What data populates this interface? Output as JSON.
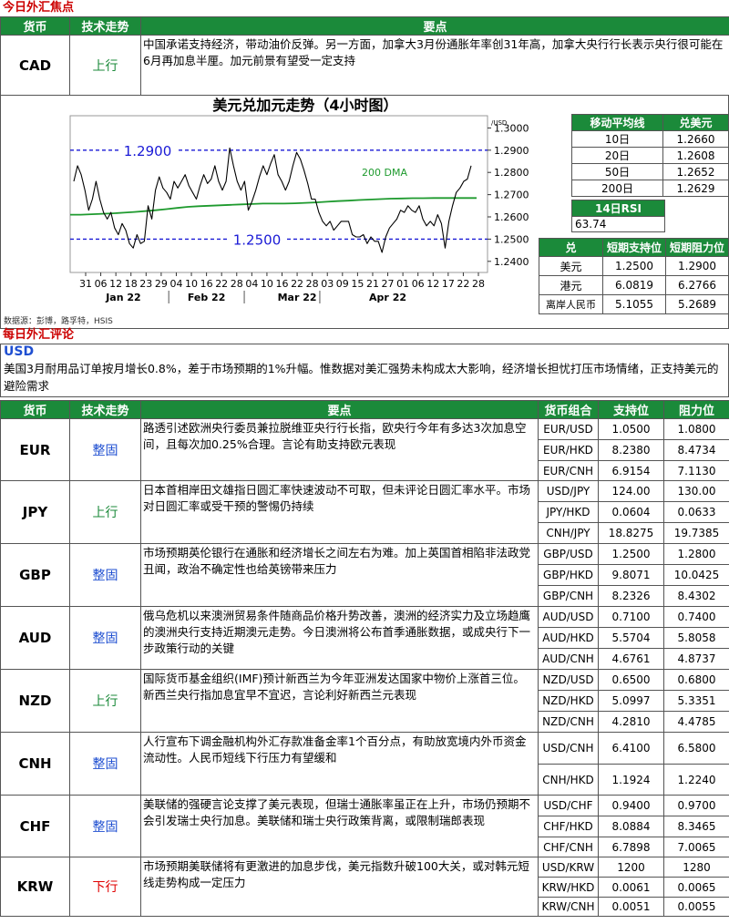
{
  "focus": {
    "section_title": "今日外汇焦点",
    "headers": {
      "currency": "货币",
      "trend": "技术走势",
      "points": "要点"
    },
    "row": {
      "currency": "CAD",
      "trend": "上行",
      "text": "中国承诺支持经济，带动油价反弹。另一方面，加拿大3月份通胀年率创31年高，加拿大央行行长表示央行很可能在6月再加息半厘。加元前景有望受一定支持"
    }
  },
  "chart_data": {
    "type": "line",
    "title": "美元兑加元走势（4小时图）",
    "ylabel": "/USD",
    "ylim": [
      1.235,
      1.3055
    ],
    "yticks": [
      "1.3000",
      "1.2900",
      "1.2800",
      "1.2700",
      "1.2600",
      "1.2500",
      "1.2400"
    ],
    "xticks": [
      "31",
      "06",
      "12",
      "18",
      "23",
      "29",
      "04",
      "10",
      "16",
      "22",
      "28",
      "04",
      "10",
      "16",
      "22",
      "28",
      "03",
      "09",
      "15",
      "21",
      "27",
      "01",
      "06",
      "12",
      "17",
      "22",
      "28"
    ],
    "month_labels": [
      "Jan 22",
      "Feb 22",
      "Mar 22",
      "Apr 22"
    ],
    "annotations": [
      {
        "text": "1.2900",
        "value": 1.29
      },
      {
        "text": "1.2500",
        "value": 1.25
      },
      {
        "text": "200 DMA"
      }
    ],
    "series": [
      {
        "values": [
          1.276,
          1.283,
          1.279,
          1.272,
          1.263,
          1.268,
          1.276,
          1.268,
          1.262,
          1.259,
          1.262,
          1.255,
          1.252,
          1.257,
          1.254,
          1.248,
          1.246,
          1.252,
          1.248,
          1.249,
          1.265,
          1.259,
          1.272,
          1.278,
          1.273,
          1.271,
          1.268,
          1.276,
          1.273,
          1.276,
          1.279,
          1.274,
          1.271,
          1.268,
          1.274,
          1.279,
          1.275,
          1.277,
          1.283,
          1.276,
          1.272,
          1.276,
          1.291,
          1.283,
          1.276,
          1.272,
          1.276,
          1.263,
          1.267,
          1.272,
          1.278,
          1.283,
          1.279,
          1.284,
          1.288,
          1.279,
          1.276,
          1.272,
          1.276,
          1.283,
          1.289,
          1.286,
          1.281,
          1.275,
          1.268,
          1.268,
          1.262,
          1.258,
          1.256,
          1.258,
          1.254,
          1.256,
          1.258,
          1.258,
          1.258,
          1.252,
          1.251,
          1.251,
          1.252,
          1.248,
          1.251,
          1.249,
          1.249,
          1.244,
          1.251,
          1.255,
          1.257,
          1.259,
          1.263,
          1.262,
          1.265,
          1.263,
          1.262,
          1.265,
          1.259,
          1.256,
          1.258,
          1.256,
          1.261,
          1.257,
          1.246,
          1.258,
          1.265,
          1.271,
          1.273,
          1.276,
          1.277,
          1.283
        ]
      },
      {
        "name": "200 DMA",
        "values": [
          1.261,
          1.261,
          1.2612,
          1.2614,
          1.2616,
          1.2619,
          1.2622,
          1.2626,
          1.263,
          1.2635,
          1.264,
          1.2645,
          1.2648,
          1.265,
          1.2652,
          1.2654,
          1.2656,
          1.2658,
          1.266,
          1.266,
          1.266,
          1.2661,
          1.2663,
          1.2665,
          1.2668,
          1.2671,
          1.2673,
          1.2676,
          1.2678,
          1.268,
          1.2682,
          1.2683,
          1.2684,
          1.2684,
          1.2685,
          1.2685,
          1.2685,
          1.2685,
          1.2685
        ]
      }
    ]
  },
  "ma_table": {
    "headers": [
      "移动平均线",
      "兑美元"
    ],
    "rows": [
      [
        "10日",
        "1.2660"
      ],
      [
        "20日",
        "1.2608"
      ],
      [
        "50日",
        "1.2652"
      ],
      [
        "200日",
        "1.2629"
      ]
    ],
    "rsi_label": "14日RSI",
    "rsi_value": "63.74"
  },
  "sr_table": {
    "headers": [
      "兑",
      "短期支持位",
      "短期阻力位"
    ],
    "rows": [
      [
        "美元",
        "1.2500",
        "1.2900"
      ],
      [
        "港元",
        "6.0819",
        "6.2766"
      ],
      [
        "离岸人民币",
        "5.1055",
        "5.2689"
      ]
    ]
  },
  "source": "数据源：彭博，路孚特，HSIS",
  "review": {
    "section_title": "每日外汇评论",
    "usd_label": "USD",
    "usd_text": "美国3月耐用品订单按月增长0.8%，差于市场预期的1%升幅。惟数据对美汇强势未构成太大影响，经济增长担忧打压市场情绪，正支持美元的避险需求",
    "headers": {
      "currency": "货币",
      "trend": "技术走势",
      "points": "要点",
      "pair": "货币组合",
      "support": "支持位",
      "resistance": "阻力位"
    },
    "rows": [
      {
        "currency": "EUR",
        "trend": "整固",
        "trend_type": "flat",
        "text": "路透引述欧洲央行委员兼拉脱维亚央行行长指，欧央行今年有多达3次加息空间，且每次加0.25%合理。言论有助支持欧元表现",
        "pairs": [
          [
            "EUR/USD",
            "1.0500",
            "1.0800"
          ],
          [
            "EUR/HKD",
            "8.2380",
            "8.4734"
          ],
          [
            "EUR/CNH",
            "6.9154",
            "7.1130"
          ]
        ]
      },
      {
        "currency": "JPY",
        "trend": "上行",
        "trend_type": "up",
        "text": "日本首相岸田文雄指日圆汇率快速波动不可取，但未评论日圆汇率水平。市场对日圆汇率或受干预的警惕仍持续",
        "pairs": [
          [
            "USD/JPY",
            "124.00",
            "130.00"
          ],
          [
            "JPY/HKD",
            "0.0604",
            "0.0633"
          ],
          [
            "CNH/JPY",
            "18.8275",
            "19.7385"
          ]
        ]
      },
      {
        "currency": "GBP",
        "trend": "整固",
        "trend_type": "flat",
        "text": "市场预期英伦银行在通胀和经济增长之间左右为难。加上英国首相陷非法政党丑闻，政治不确定性也给英镑带来压力",
        "pairs": [
          [
            "GBP/USD",
            "1.2500",
            "1.2800"
          ],
          [
            "GBP/HKD",
            "9.8071",
            "10.0425"
          ],
          [
            "GBP/CNH",
            "8.2326",
            "8.4302"
          ]
        ]
      },
      {
        "currency": "AUD",
        "trend": "整固",
        "trend_type": "flat",
        "text": "俄乌危机以来澳洲贸易条件随商品价格升势改善，澳洲的经济实力及立场趋鹰的澳洲央行支持近期澳元走势。今日澳洲将公布首季通胀数据，或成央行下一步政策行动的关键",
        "pairs": [
          [
            "AUD/USD",
            "0.7100",
            "0.7400"
          ],
          [
            "AUD/HKD",
            "5.5704",
            "5.8058"
          ],
          [
            "AUD/CNH",
            "4.6761",
            "4.8737"
          ]
        ]
      },
      {
        "currency": "NZD",
        "trend": "上行",
        "trend_type": "up",
        "text": "国际货币基金组织(IMF)预计新西兰为今年亚洲发达国家中物价上涨首三位。新西兰央行指加息宜早不宜迟，言论利好新西兰元表现",
        "pairs": [
          [
            "NZD/USD",
            "0.6500",
            "0.6800"
          ],
          [
            "NZD/HKD",
            "5.0997",
            "5.3351"
          ],
          [
            "NZD/CNH",
            "4.2810",
            "4.4785"
          ]
        ]
      },
      {
        "currency": "CNH",
        "trend": "整固",
        "trend_type": "flat",
        "text": "人行宣布下调金融机构外汇存款准备金率1个百分点，有助放宽境内外币资金流动性。人民币短线下行压力有望缓和",
        "pairs": [
          [
            "USD/CNH",
            "6.4100",
            "6.5800"
          ],
          [
            "CNH/HKD",
            "1.1924",
            "1.2240"
          ]
        ]
      },
      {
        "currency": "CHF",
        "trend": "整固",
        "trend_type": "flat",
        "text": "美联储的强硬言论支撑了美元表现，但瑞士通胀率虽正在上升，市场仍预期不会引发瑞士央行加息。美联储和瑞士央行政策背离，或限制瑞郎表现",
        "pairs": [
          [
            "USD/CHF",
            "0.9400",
            "0.9700"
          ],
          [
            "CHF/HKD",
            "8.0884",
            "8.3465"
          ],
          [
            "CHF/CNH",
            "6.7898",
            "7.0065"
          ]
        ]
      },
      {
        "currency": "KRW",
        "trend": "下行",
        "trend_type": "down",
        "text": "市场预期美联储将有更激进的加息步伐，美元指数升破100大关，或对韩元短线走势构成一定压力",
        "pairs": [
          [
            "USD/KRW",
            "1200",
            "1280"
          ],
          [
            "KRW/HKD",
            "0.0061",
            "0.0065"
          ],
          [
            "KRW/CNH",
            "0.0051",
            "0.0055"
          ]
        ]
      }
    ]
  }
}
